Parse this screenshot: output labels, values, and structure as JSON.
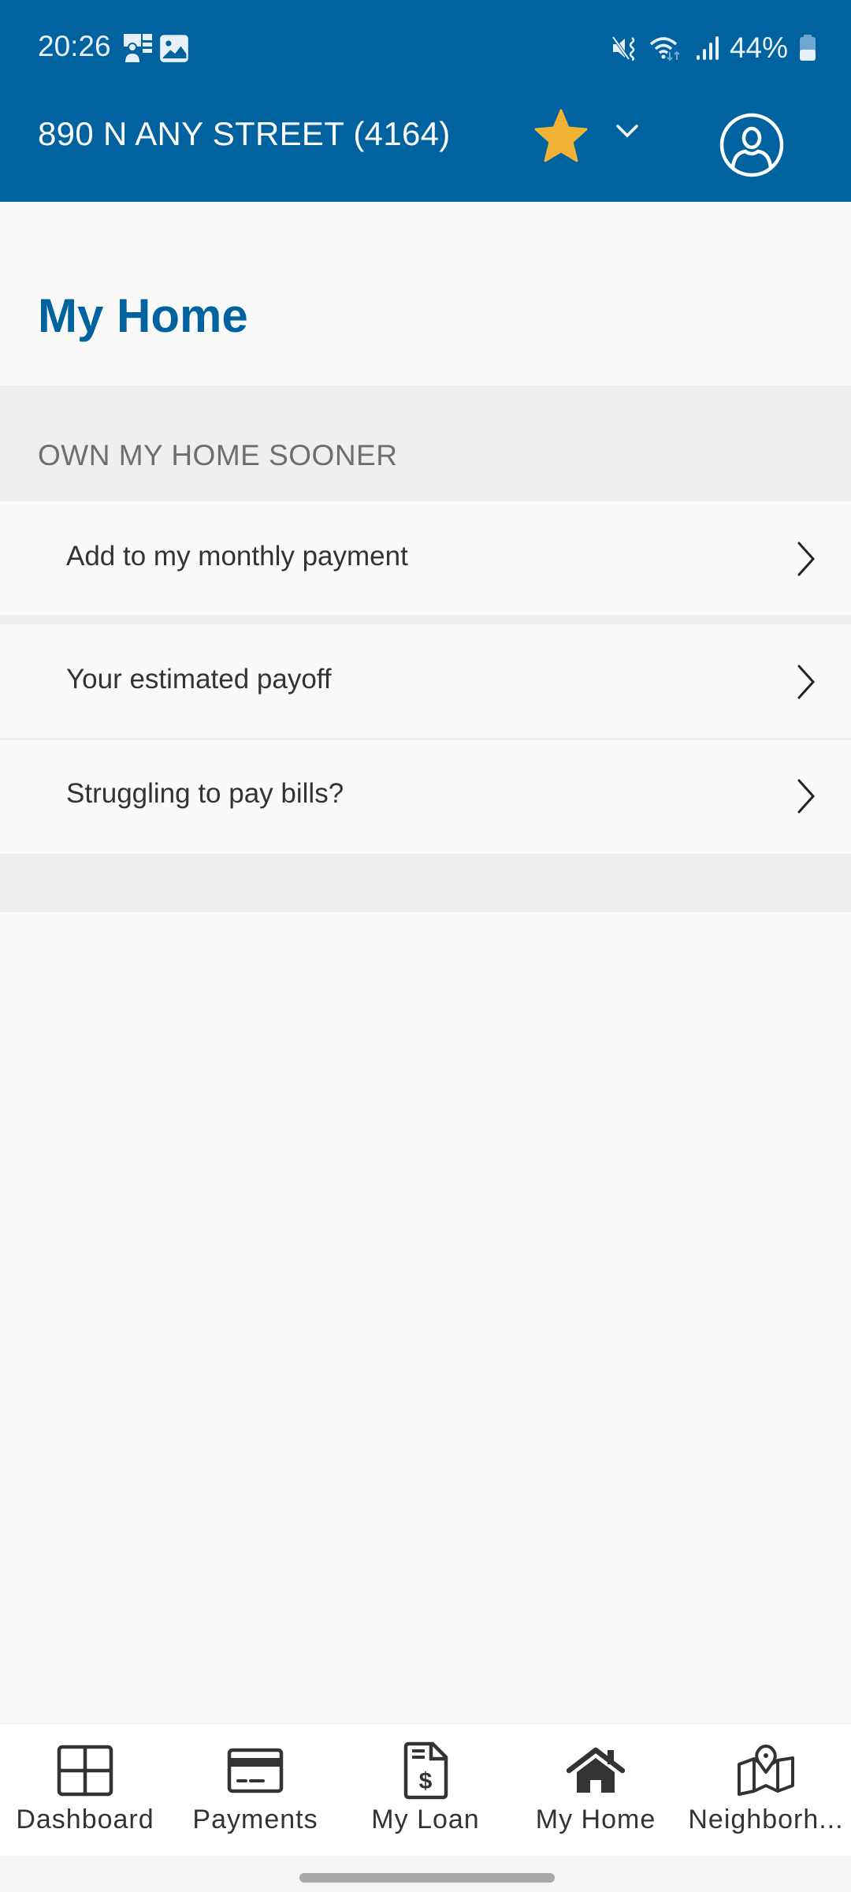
{
  "status_bar": {
    "time": "20:26",
    "notification_icons": [
      "contact-card-icon",
      "image-icon"
    ],
    "system_icons": [
      "vibrate-mute-icon",
      "wifi-icon",
      "signal-icon"
    ],
    "battery_percent": "44%",
    "battery_level": 0.44
  },
  "header": {
    "address": "890 N ANY STREET (4164)",
    "favorite_icon": "star-icon",
    "favorite_color": "#f2b233",
    "dropdown_icon": "chevron-down-icon",
    "profile_icon": "user-circle-icon",
    "background_color": "#00639f"
  },
  "page": {
    "title": "My Home",
    "title_color": "#00639f"
  },
  "section": {
    "title": "OWN MY HOME SOONER",
    "items": [
      {
        "label": "Add to my monthly payment",
        "icon": "chevron-right-icon"
      },
      {
        "label": "Your estimated payoff",
        "icon": "chevron-right-icon"
      },
      {
        "label": "Struggling to pay bills?",
        "icon": "chevron-right-icon"
      }
    ]
  },
  "bottom_nav": {
    "items": [
      {
        "label": "Dashboard",
        "icon": "grid-icon",
        "active": false
      },
      {
        "label": "Payments",
        "icon": "credit-card-icon",
        "active": false
      },
      {
        "label": "My Loan",
        "icon": "loan-document-icon",
        "active": false
      },
      {
        "label": "My Home",
        "icon": "home-icon",
        "active": true
      },
      {
        "label": "Neighborh...",
        "icon": "map-pin-icon",
        "active": false
      }
    ]
  }
}
